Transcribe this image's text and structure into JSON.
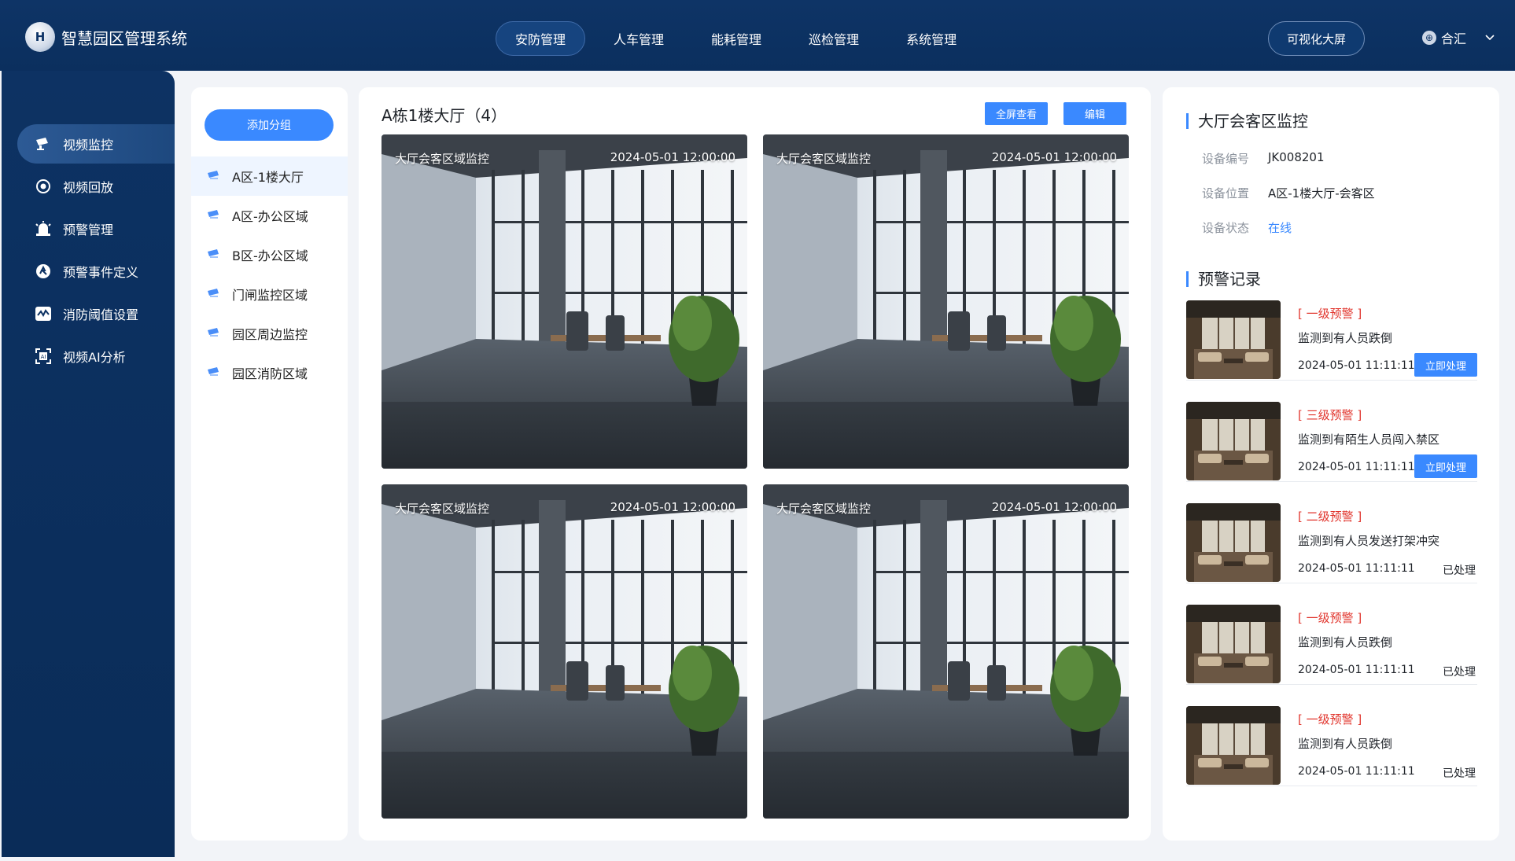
{
  "app": {
    "title": "智慧园区管理系统",
    "logo_text": "H"
  },
  "nav": {
    "items": [
      "安防管理",
      "人车管理",
      "能耗管理",
      "巡检管理",
      "系统管理"
    ],
    "active_index": 0,
    "screen_button": "可视化大屏"
  },
  "user": {
    "name": "合汇",
    "avatar_glyph": "⊕"
  },
  "sidebar": {
    "items": [
      {
        "label": "视频监控",
        "icon": "camera-icon"
      },
      {
        "label": "视频回放",
        "icon": "replay-icon"
      },
      {
        "label": "预警管理",
        "icon": "alarm-icon"
      },
      {
        "label": "预警事件定义",
        "icon": "event-icon"
      },
      {
        "label": "消防阈值设置",
        "icon": "threshold-icon"
      },
      {
        "label": "视频AI分析",
        "icon": "ai-icon"
      }
    ],
    "active_index": 0
  },
  "groups": {
    "add_button": "添加分组",
    "items": [
      "A区-1楼大厅",
      "A区-办公区域",
      "B区-办公区域",
      "门闸监控区域",
      "园区周边监控",
      "园区消防区域"
    ],
    "active_index": 0
  },
  "video": {
    "title": "A栋1楼大厅（4）",
    "fullscreen_button": "全屏查看",
    "edit_button": "编辑",
    "tiles": [
      {
        "label": "大厅会客区域监控",
        "time": "2024-05-01 12:00:00"
      },
      {
        "label": "大厅会客区域监控",
        "time": "2024-05-01 12:00:00"
      },
      {
        "label": "大厅会客区域监控",
        "time": "2024-05-01 12:00:00"
      },
      {
        "label": "大厅会客区域监控",
        "time": "2024-05-01 12:00:00"
      }
    ]
  },
  "device": {
    "title": "大厅会客区监控",
    "fields": [
      {
        "key": "设备编号",
        "value": "JK008201"
      },
      {
        "key": "设备位置",
        "value": "A区-1楼大厅-会客区"
      },
      {
        "key": "设备状态",
        "value": "在线"
      }
    ]
  },
  "alerts": {
    "title": "预警记录",
    "process_label": "立即处理",
    "done_label": "已处理",
    "items": [
      {
        "level": "[ 一级预警 ]",
        "desc": "监测到有人员跌倒",
        "time": "2024-05-01 11:11:11",
        "handled": false
      },
      {
        "level": "[ 三级预警 ]",
        "desc": "监测到有陌生人员闯入禁区",
        "time": "2024-05-01 11:11:11",
        "handled": false
      },
      {
        "level": "[ 二级预警 ]",
        "desc": "监测到有人员发送打架冲突",
        "time": "2024-05-01 11:11:11",
        "handled": true
      },
      {
        "level": "[ 一级预警 ]",
        "desc": "监测到有人员跌倒",
        "time": "2024-05-01 11:11:11",
        "handled": true
      },
      {
        "level": "[ 一级预警 ]",
        "desc": "监测到有人员跌倒",
        "time": "2024-05-01 11:11:11",
        "handled": true
      }
    ]
  },
  "colors": {
    "primary": "#3a89ff",
    "header": "#0e3466",
    "alert": "#e1352d"
  }
}
